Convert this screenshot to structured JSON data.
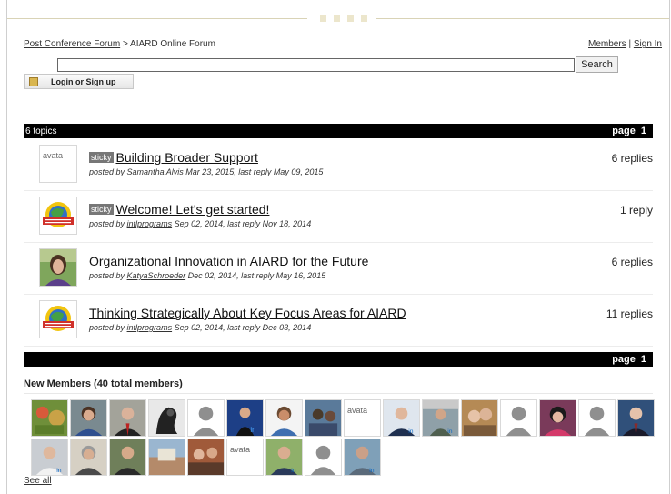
{
  "breadcrumb": {
    "parent": "Post Conference Forum",
    "separator": ">",
    "current": "AIARD Online Forum"
  },
  "top_links": {
    "members": "Members",
    "separator": "|",
    "sign_in": "Sign In"
  },
  "search": {
    "value": "",
    "placeholder": "",
    "button": "Search"
  },
  "login_button": "Login or Sign up",
  "topics_bar": {
    "count": "6 topics",
    "page_label": "page",
    "page_number": "1"
  },
  "bottom_bar": {
    "page_label": "page",
    "page_number": "1"
  },
  "topics": [
    {
      "sticky": "sticky",
      "title": "Building Broader Support",
      "posted_by": "posted by",
      "author": "Samantha Alvis",
      "meta": "Mar 23, 2015, last reply May 09, 2015",
      "replies": "6 replies",
      "avatar_alt": "avata"
    },
    {
      "sticky": "sticky",
      "title": "Welcome! Let's get started!",
      "posted_by": "posted by",
      "author": "intlprograms",
      "meta": "Sep 02, 2014, last reply Nov 18, 2014",
      "replies": "1 reply"
    },
    {
      "title": "Organizational Innovation in AIARD for the Future",
      "posted_by": "posted by",
      "author": "KatyaSchroeder",
      "meta": "Dec 02, 2014, last reply May 16, 2015",
      "replies": "6 replies"
    },
    {
      "title": "Thinking Strategically About Key Focus Areas for AIARD",
      "posted_by": "posted by",
      "author": "intlprograms",
      "meta": "Sep 02, 2014, last reply Dec 03, 2014",
      "replies": "11 replies"
    }
  ],
  "members": {
    "heading": "New Members (40 total members)",
    "see_all": "See all",
    "broken_alt": "avata"
  },
  "colors": {
    "bar": "#000000",
    "sticky_badge": "#777777",
    "accent": "#ece6cc"
  }
}
